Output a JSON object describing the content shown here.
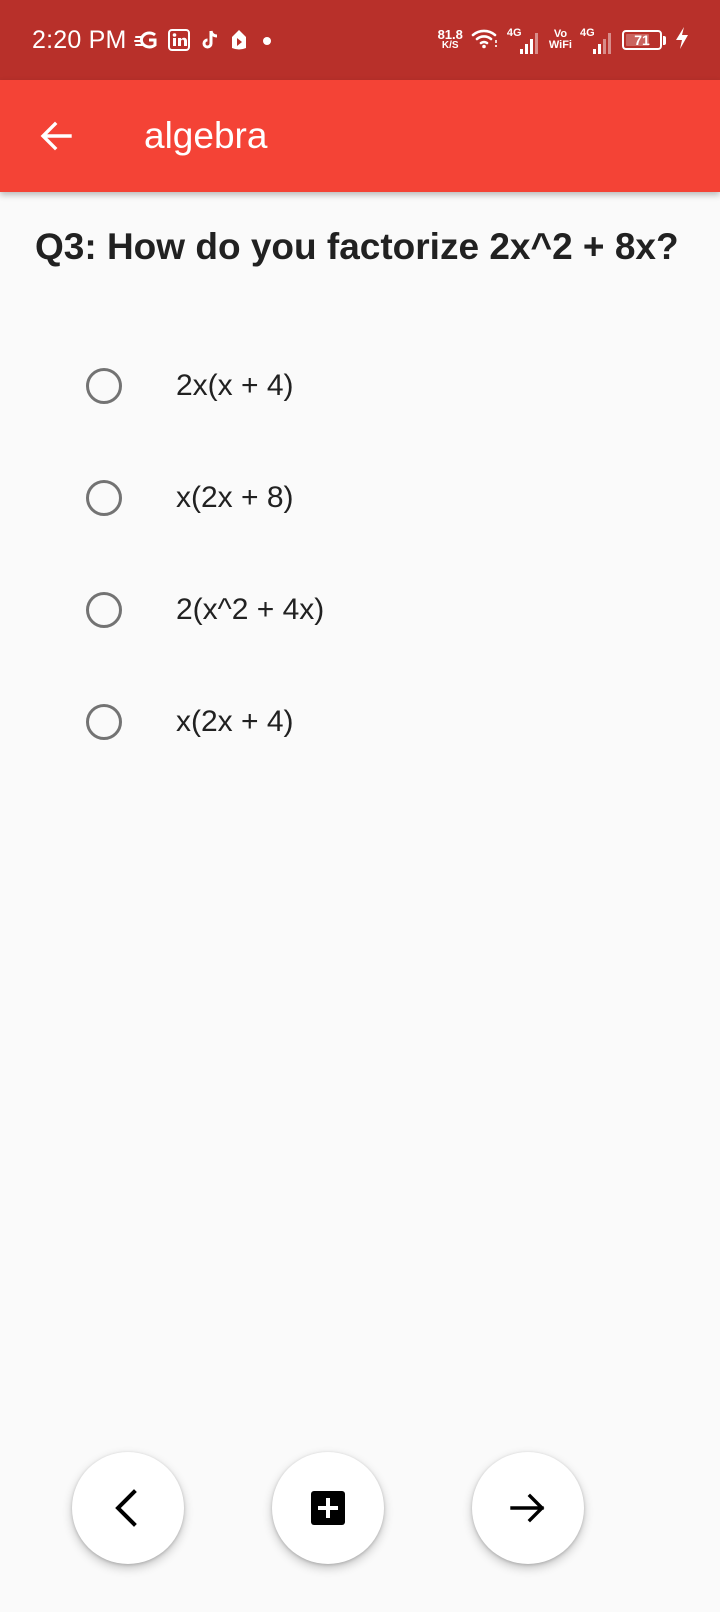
{
  "status_bar": {
    "time": "2:20 PM",
    "net_speed_value": "81.8",
    "net_speed_unit": "K/S",
    "network_type_1": "4G",
    "vowifi_top": "Vo",
    "vowifi_bottom": "WiFi",
    "network_type_2": "4G",
    "battery_level": "71",
    "notification_icons": [
      "gaana-icon",
      "linkedin-icon",
      "tiktok-icon",
      "app-icon",
      "dot-icon"
    ]
  },
  "app_bar": {
    "title": "algebra",
    "back_icon": "arrow-left-icon",
    "background": "#f44336",
    "status_bar_color": "#b8302a"
  },
  "quiz": {
    "question": "Q3: How do you factorize 2x^2 + 8x?",
    "options": [
      {
        "label": "2x(x + 4)",
        "selected": false
      },
      {
        "label": "x(2x + 8)",
        "selected": false
      },
      {
        "label": "2(x^2 + 4x)",
        "selected": false
      },
      {
        "label": "x(2x + 4)",
        "selected": false
      }
    ]
  },
  "bottom_actions": {
    "previous_icon": "chevron-left-icon",
    "add_icon": "add-box-icon",
    "next_icon": "arrow-right-icon"
  }
}
